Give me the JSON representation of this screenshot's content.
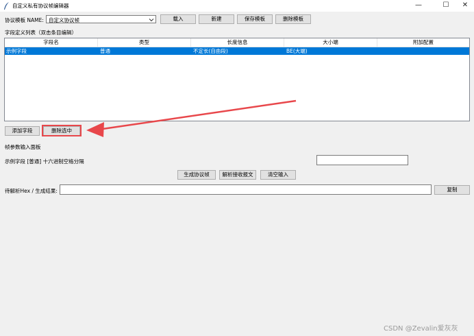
{
  "window": {
    "title": "自定义私有协议帧编辑器",
    "minimize_glyph": "—",
    "maximize_glyph": "☐",
    "close_glyph": "✕"
  },
  "template_row": {
    "label": "协议模板 NAME:",
    "selected": "自定义协议帧",
    "load_button": "载入",
    "new_button": "新建",
    "save_button": "保存模板",
    "delete_button": "删除模板"
  },
  "field_list": {
    "label": "字段定义列表（双击条目编辑）",
    "columns": [
      "字段名",
      "类型",
      "长度信息",
      "大小端",
      "附加配置"
    ],
    "rows": [
      [
        "示例字段",
        "普通",
        "不定长(自由段)",
        "BE(大端)",
        ""
      ]
    ],
    "add_button": "添加字段",
    "delete_selected_button": "删除选中"
  },
  "params": {
    "label": "帧参数输入面板",
    "field_row_label": "示例字段 [普通]  十六进制空格分隔",
    "field_value": "",
    "generate_button": "生成协议帧",
    "parse_button": "解析接收报文",
    "clear_button": "清空输入"
  },
  "result": {
    "label": "待解析Hex / 生成结果:",
    "value": "",
    "copy_button": "复制"
  },
  "watermark": "CSDN @Zevalin爱灰灰",
  "colors": {
    "selection": "#0078d7",
    "annotation_red": "#e8474b"
  }
}
